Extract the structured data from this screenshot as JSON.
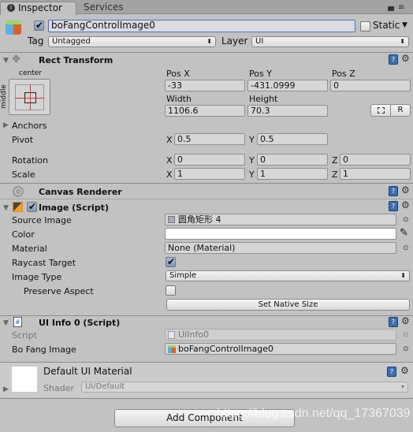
{
  "tabs": [
    {
      "label": "Inspector",
      "active": true
    },
    {
      "label": "Services",
      "active": false
    }
  ],
  "object": {
    "active": true,
    "name": "boFangControlImage0",
    "static_label": "Static",
    "static": false,
    "tag_label": "Tag",
    "tag": "Untagged",
    "layer_label": "Layer",
    "layer": "UI"
  },
  "rect_transform": {
    "title": "Rect Transform",
    "anchor_h": "center",
    "anchor_v": "middle",
    "pos_x_label": "Pos X",
    "pos_y_label": "Pos Y",
    "pos_z_label": "Pos Z",
    "pos_x": "-33",
    "pos_y": "-431.0999",
    "pos_z": "0",
    "width_label": "Width",
    "height_label": "Height",
    "width": "1106.6",
    "height": "70.3",
    "r_button": "R",
    "anchors_label": "Anchors",
    "pivot_label": "Pivot",
    "pivot_x": "0.5",
    "pivot_y": "0.5",
    "rotation_label": "Rotation",
    "rot_x": "0",
    "rot_y": "0",
    "rot_z": "0",
    "scale_label": "Scale",
    "scale_x": "1",
    "scale_y": "1",
    "scale_z": "1",
    "x": "X",
    "y": "Y",
    "z": "Z"
  },
  "canvas_renderer": {
    "title": "Canvas Renderer"
  },
  "image": {
    "title": "Image (Script)",
    "enabled": true,
    "source_label": "Source Image",
    "source": "圆角矩形 4",
    "color_label": "Color",
    "color": "#ffffff",
    "material_label": "Material",
    "material": "None (Material)",
    "raycast_label": "Raycast Target",
    "raycast": true,
    "type_label": "Image Type",
    "type": "Simple",
    "preserve_label": "Preserve Aspect",
    "preserve": false,
    "native_button": "Set Native Size"
  },
  "ui_info": {
    "title": "UI Info 0 (Script)",
    "script_label": "Script",
    "script": "UIInfo0",
    "bofang_label": "Bo Fang Image",
    "bofang": "boFangControlImage0"
  },
  "material": {
    "title": "Default UI Material",
    "shader_label": "Shader",
    "shader": "UI/Default"
  },
  "add_component": "Add Component",
  "watermark": "https://blog.csdn.net/qq_17367039"
}
